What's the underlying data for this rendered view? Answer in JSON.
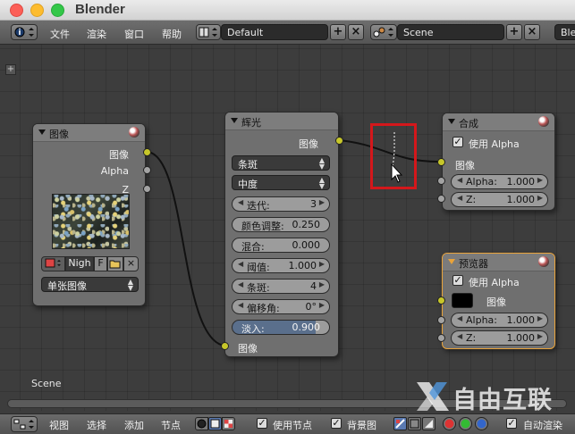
{
  "window": {
    "title": "Blender"
  },
  "top_header": {
    "menus": [
      "文件",
      "渲染",
      "窗口",
      "帮助"
    ],
    "screen_layout": "Default",
    "scene": "Scene",
    "render_engine_cut": "Ble"
  },
  "editor": {
    "scene_label": "Scene"
  },
  "nodes": {
    "image": {
      "title": "图像",
      "outputs": [
        "图像",
        "Alpha",
        "Z"
      ],
      "image_name": "Nigh",
      "f_label": "F",
      "source": "单张图像"
    },
    "glare": {
      "title": "辉光",
      "output": "图像",
      "type": "条斑",
      "quality": "中度",
      "params": [
        {
          "label": "迭代:",
          "value": "3"
        },
        {
          "label": "颜色调整:",
          "value": "0.250"
        },
        {
          "label": "混合:",
          "value": "0.000"
        },
        {
          "label": "阈值:",
          "value": "1.000"
        },
        {
          "label": "条斑:",
          "value": "4"
        },
        {
          "label": "偏移角:",
          "value": "0°"
        }
      ],
      "fade": {
        "label": "淡入:",
        "value": "0.900"
      },
      "input": "图像"
    },
    "composite": {
      "title": "合成",
      "use_alpha": "使用 Alpha",
      "input": "图像",
      "alpha": {
        "label": "Alpha:",
        "value": "1.000"
      },
      "z": {
        "label": "Z:",
        "value": "1.000"
      }
    },
    "viewer": {
      "title": "预览器",
      "use_alpha": "使用 Alpha",
      "input": "图像",
      "alpha": {
        "label": "Alpha:",
        "value": "1.000"
      },
      "z": {
        "label": "Z:",
        "value": "1.000"
      }
    }
  },
  "bottom_header": {
    "menus": [
      "视图",
      "选择",
      "添加",
      "节点"
    ],
    "use_nodes": "使用节点",
    "backdrop": "背景图",
    "auto_render": "自动渲染"
  },
  "watermark": {
    "text": "自由互联"
  },
  "colors": {
    "socket_yellow": "#c7c72a",
    "socket_grey": "#a3a3a3",
    "highlight_red": "#d4171b",
    "active_node_border": "#e9a33a"
  }
}
